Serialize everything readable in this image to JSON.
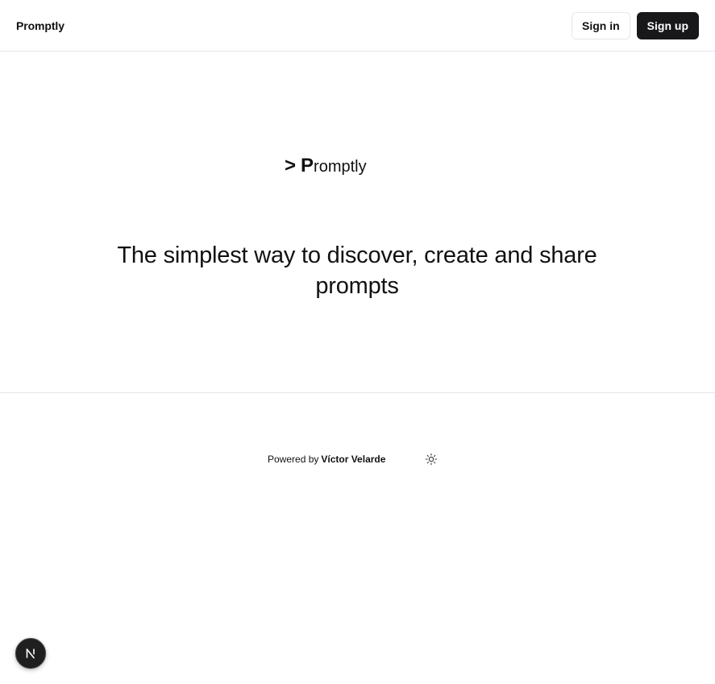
{
  "header": {
    "brand": "Promptly",
    "sign_in_label": "Sign in",
    "sign_up_label": "Sign up"
  },
  "hero": {
    "logo_prompt_char": ">",
    "logo_initial": "P",
    "logo_rest": "romptly",
    "tagline": "The simplest way to discover, create and share prompts"
  },
  "footer": {
    "powered_by": "Powered by",
    "author": "Víctor Velarde",
    "theme_icon": "sun-icon"
  },
  "badge": {
    "icon": "n-logo-icon"
  }
}
